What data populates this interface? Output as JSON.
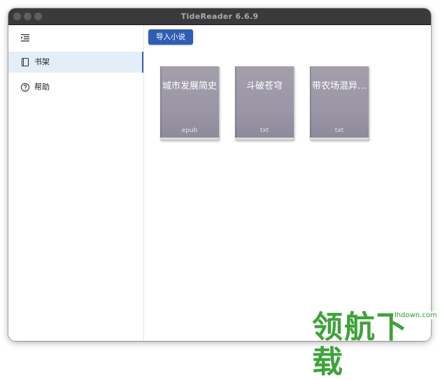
{
  "window": {
    "title": "TideReader 6.6.9"
  },
  "sidebar": {
    "items": [
      {
        "label": "书架",
        "icon": "book-icon",
        "active": true
      },
      {
        "label": "帮助",
        "icon": "help-icon",
        "active": false
      }
    ]
  },
  "toolbar": {
    "import_label": "导入小说"
  },
  "books": [
    {
      "title": "城市发展简史",
      "format": "epub"
    },
    {
      "title": "斗破苍穹",
      "format": "txt"
    },
    {
      "title": "带农场混异…",
      "format": "txt"
    }
  ],
  "watermark": {
    "text": "领航下载",
    "url": "lhdown.com"
  },
  "colors": {
    "accent": "#2f5db3",
    "book_cover": "#9a96a5",
    "active_nav": "#e3eef8"
  }
}
